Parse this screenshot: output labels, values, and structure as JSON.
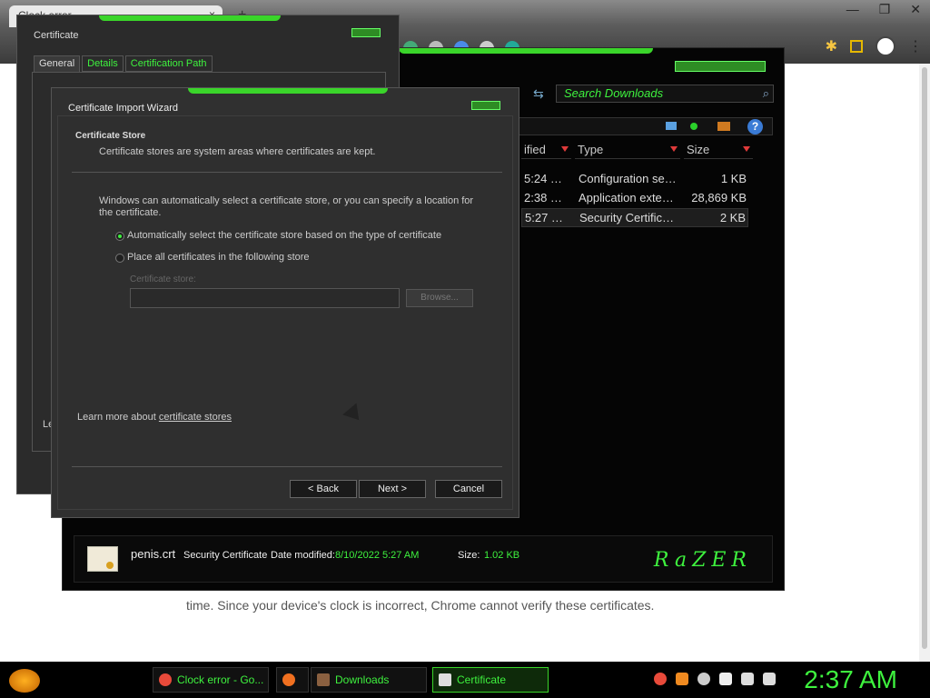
{
  "browser": {
    "tab_title": "Clock error",
    "tab_close": "×",
    "new_tab": "+",
    "page_text": "time. Since your device's clock is incorrect, Chrome cannot verify these certificates."
  },
  "explorer": {
    "search_placeholder": "Search Downloads",
    "columns": [
      {
        "label": "ified"
      },
      {
        "label": "Type"
      },
      {
        "label": "Size"
      }
    ],
    "rows": [
      {
        "date": "5:24 …",
        "type": "Configuration se…",
        "size": "1 KB"
      },
      {
        "date": "2:38 …",
        "type": "Application exte…",
        "size": "28,869 KB"
      },
      {
        "date": "5:27 …",
        "type": "Security Certific…",
        "size": "2 KB"
      }
    ],
    "details": {
      "filename": "penis.crt",
      "filetype": "Security Certificate",
      "date_label": "Date modified:",
      "date_value": "8/10/2022 5:27 AM",
      "size_label": "Size:",
      "size_value": "1.02 KB"
    },
    "logo": "RaZER"
  },
  "certificate": {
    "title": "Certificate",
    "tabs": [
      "General",
      "Details",
      "Certification Path"
    ],
    "partial_text": "Le"
  },
  "wizard": {
    "title": "Certificate Import Wizard",
    "heading": "Certificate Store",
    "subheading": "Certificate stores are system areas where certificates are kept.",
    "description": "Windows can automatically select a certificate store, or you can specify a location for the certificate.",
    "option_auto": "Automatically select the certificate store based on the type of certificate",
    "option_manual": "Place all certificates in the following store",
    "store_label": "Certificate store:",
    "browse": "Browse...",
    "learn_prefix": "Learn more about ",
    "learn_link": "certificate stores",
    "back": "< Back",
    "next": "Next >",
    "cancel": "Cancel"
  },
  "taskbar": {
    "items": [
      {
        "label": "Clock error - Go..."
      },
      {
        "label": "Downloads"
      },
      {
        "label": "Certificate"
      }
    ],
    "clock": "2:37 AM"
  },
  "colors": {
    "accent": "#3ef23e",
    "window_bg": "#303030"
  }
}
